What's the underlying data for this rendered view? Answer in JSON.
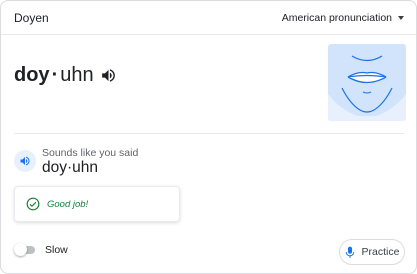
{
  "header": {
    "title": "Doyen",
    "accent_selector": "American pronunciation",
    "accent_icon": "dropdown-caret-icon"
  },
  "pronunciation": {
    "stressed_syllable": "doy",
    "separator": "·",
    "unstressed_syllable": "uhn",
    "speaker_icon": "speaker-icon"
  },
  "mouth_illustration": {
    "icon": "mouth-diagram",
    "background_color": "#d2e3fc",
    "line_color": "#1a73e8"
  },
  "you_said": {
    "caption": "Sounds like you said",
    "word": "doy·uhn",
    "speaker_icon": "speaker-icon"
  },
  "feedback": {
    "message": "Good job!",
    "icon": "check-circle-icon",
    "color": "#188038"
  },
  "slow_toggle": {
    "label": "Slow",
    "enabled": false
  },
  "practice_button": {
    "label": "Practice",
    "icon": "microphone-icon",
    "icon_color": "#1a73e8"
  }
}
